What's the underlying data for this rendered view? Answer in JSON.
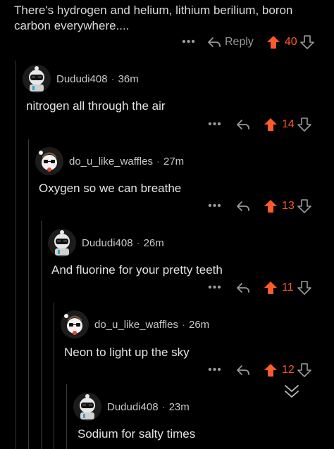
{
  "top_comment": {
    "text": "There's hydrogen and helium, lithium berilium, boron carbon everywhere....",
    "reply_label": "Reply",
    "votes": "40"
  },
  "comments": [
    {
      "user": "Dududi408",
      "time": "36m",
      "text": "nitrogen all through the air",
      "votes": "14",
      "avatar": "astronaut-avatar"
    },
    {
      "user": "do_u_like_waffles",
      "time": "27m",
      "text": "Oxygen so we can breathe",
      "votes": "13",
      "avatar": "waffles-avatar"
    },
    {
      "user": "Dududi408",
      "time": "26m",
      "text": "And fluorine for your pretty teeth",
      "votes": "11",
      "avatar": "astronaut-avatar"
    },
    {
      "user": "do_u_like_waffles",
      "time": "26m",
      "text": "Neon to light up the sky",
      "votes": "12",
      "avatar": "waffles-avatar"
    },
    {
      "user": "Dududi408",
      "time": "23m",
      "text": "Sodium for salty times",
      "votes": "",
      "avatar": "astronaut-avatar"
    }
  ],
  "icons": {
    "more": "more-options-icon",
    "reply": "reply-arrow-icon",
    "upvote": "upvote-arrow-icon",
    "downvote": "downvote-arrow-icon",
    "collapse": "collapse-chevron-icon"
  },
  "colors": {
    "background": "#000000",
    "upvote_active": "#ff5a2c",
    "thread_line": "#3a3a3c",
    "muted": "#9a9a9a"
  },
  "separator": "·",
  "more_dots": "•••"
}
